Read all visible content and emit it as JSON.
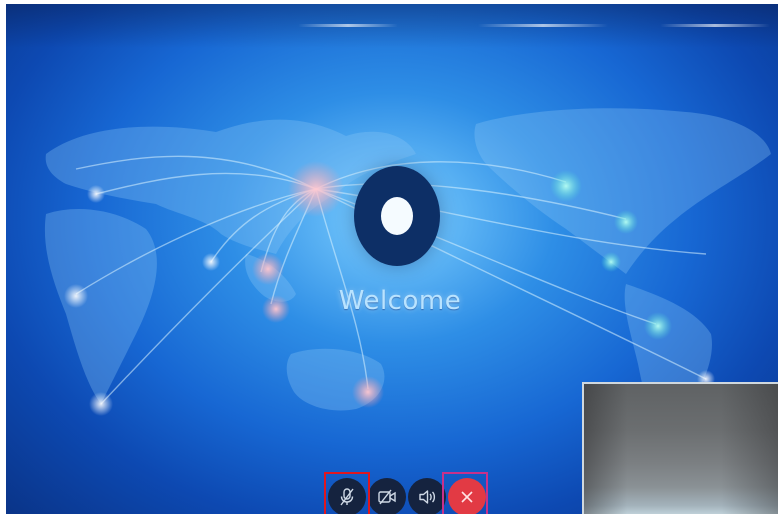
{
  "welcome": {
    "text": "Welcome"
  },
  "controls": {
    "mute_microphone": {
      "icon": "microphone-muted-icon"
    },
    "camera": {
      "icon": "camera-off-icon"
    },
    "speaker": {
      "icon": "speaker-icon"
    },
    "end_call": {
      "icon": "close-icon"
    }
  },
  "colors": {
    "background_blue": "#1767d3",
    "glow_cyan": "#7fd0ff",
    "logo_navy": "#0d2f66",
    "control_dark": "#15233f",
    "end_call_red": "#e23a44",
    "highlight_red": "#e0171f",
    "highlight_pink": "#c8318a"
  }
}
